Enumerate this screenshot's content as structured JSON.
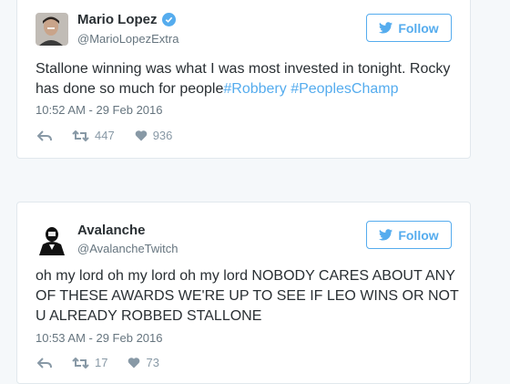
{
  "colors": {
    "accent": "#55acee",
    "text": "#292f33",
    "muted": "#66757f",
    "icon": "#8899a6",
    "border": "#e1e8ed"
  },
  "tweets": [
    {
      "display_name": "Mario Lopez",
      "verified": true,
      "handle": "@MarioLopezExtra",
      "follow_label": "Follow",
      "text_plain": "Stallone winning was what I was most invested in tonight. Rocky has done so much for people",
      "hashtags": [
        "#Robbery",
        "#PeoplesChamp"
      ],
      "timestamp": "10:52 AM - 29 Feb 2016",
      "retweets": "447",
      "likes": "936"
    },
    {
      "display_name": "Avalanche",
      "verified": false,
      "handle": "@AvalancheTwitch",
      "follow_label": "Follow",
      "text_plain": "oh my lord oh my lord oh my lord NOBODY CARES ABOUT ANY OF THESE AWARDS WE'RE UP TO SEE IF LEO WINS OR NOT U ALREADY ROBBED STALLONE",
      "hashtags": [],
      "timestamp": "10:53 AM - 29 Feb 2016",
      "retweets": "17",
      "likes": "73"
    }
  ]
}
